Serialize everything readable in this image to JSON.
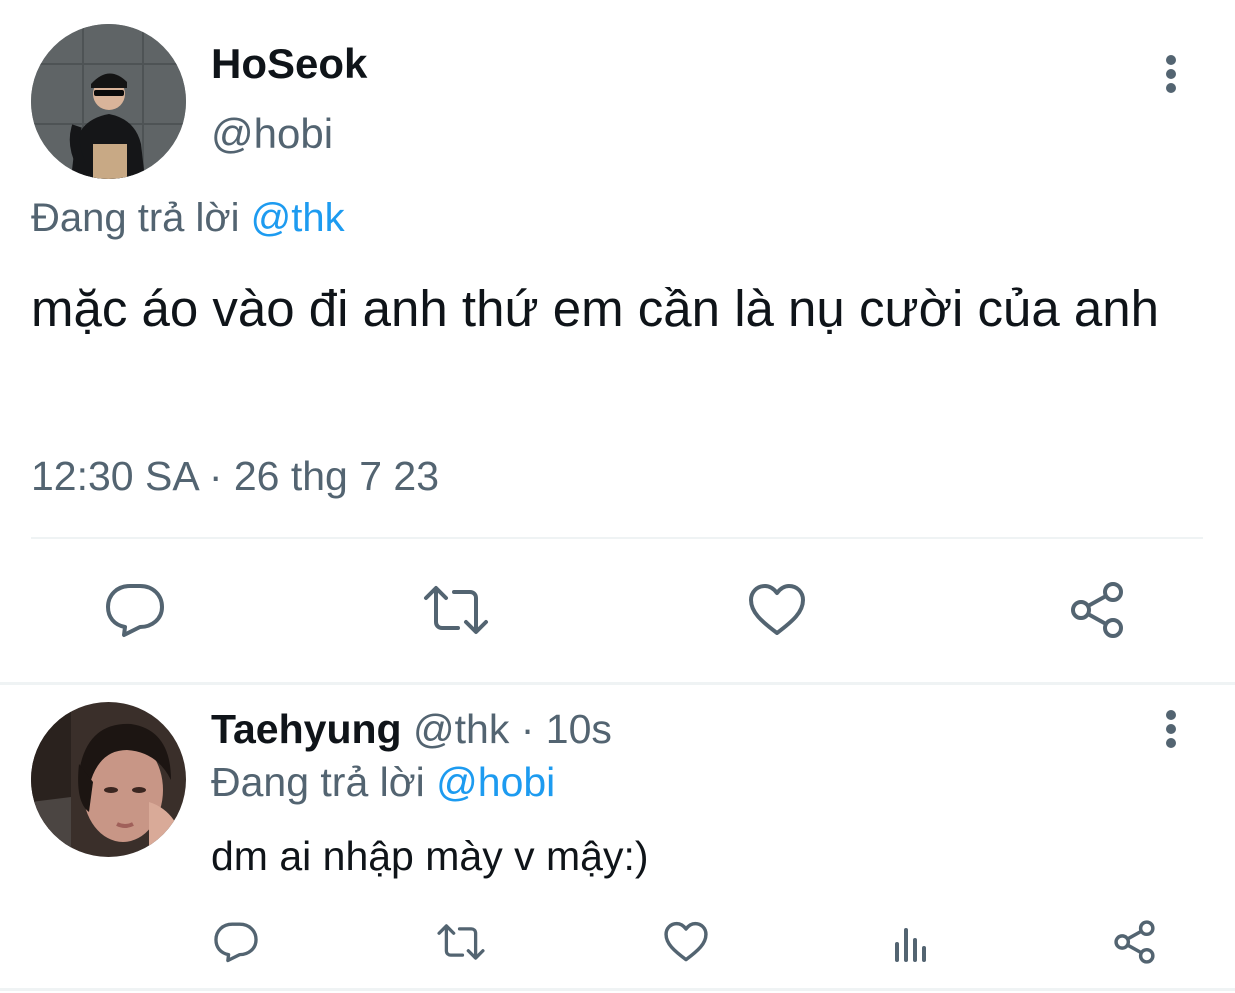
{
  "main_tweet": {
    "author_name": "HoSeok",
    "author_handle": "@hobi",
    "replying_to_label": "Đang trả lời",
    "replying_to_handle": "@thk",
    "text": "mặc áo vào đi anh thứ em cần là nụ cười của anh",
    "timestamp": "12:30 SA · 26 thg 7 23",
    "actions": [
      "reply-icon",
      "retweet-icon",
      "like-icon",
      "share-icon"
    ]
  },
  "reply_tweet": {
    "author_name": "Taehyung",
    "author_handle": "@thk",
    "separator": " · ",
    "time_ago": "10s",
    "replying_to_label": "Đang trả lời",
    "replying_to_handle": "@hobi",
    "text": "dm ai nhập mày v mậy:)",
    "actions": [
      "reply-icon",
      "retweet-icon",
      "like-icon",
      "stats-icon",
      "share-icon"
    ]
  },
  "colors": {
    "text_primary": "#0f1419",
    "text_secondary": "#536471",
    "accent": "#1d9bf0",
    "divider": "#eff3f4"
  }
}
